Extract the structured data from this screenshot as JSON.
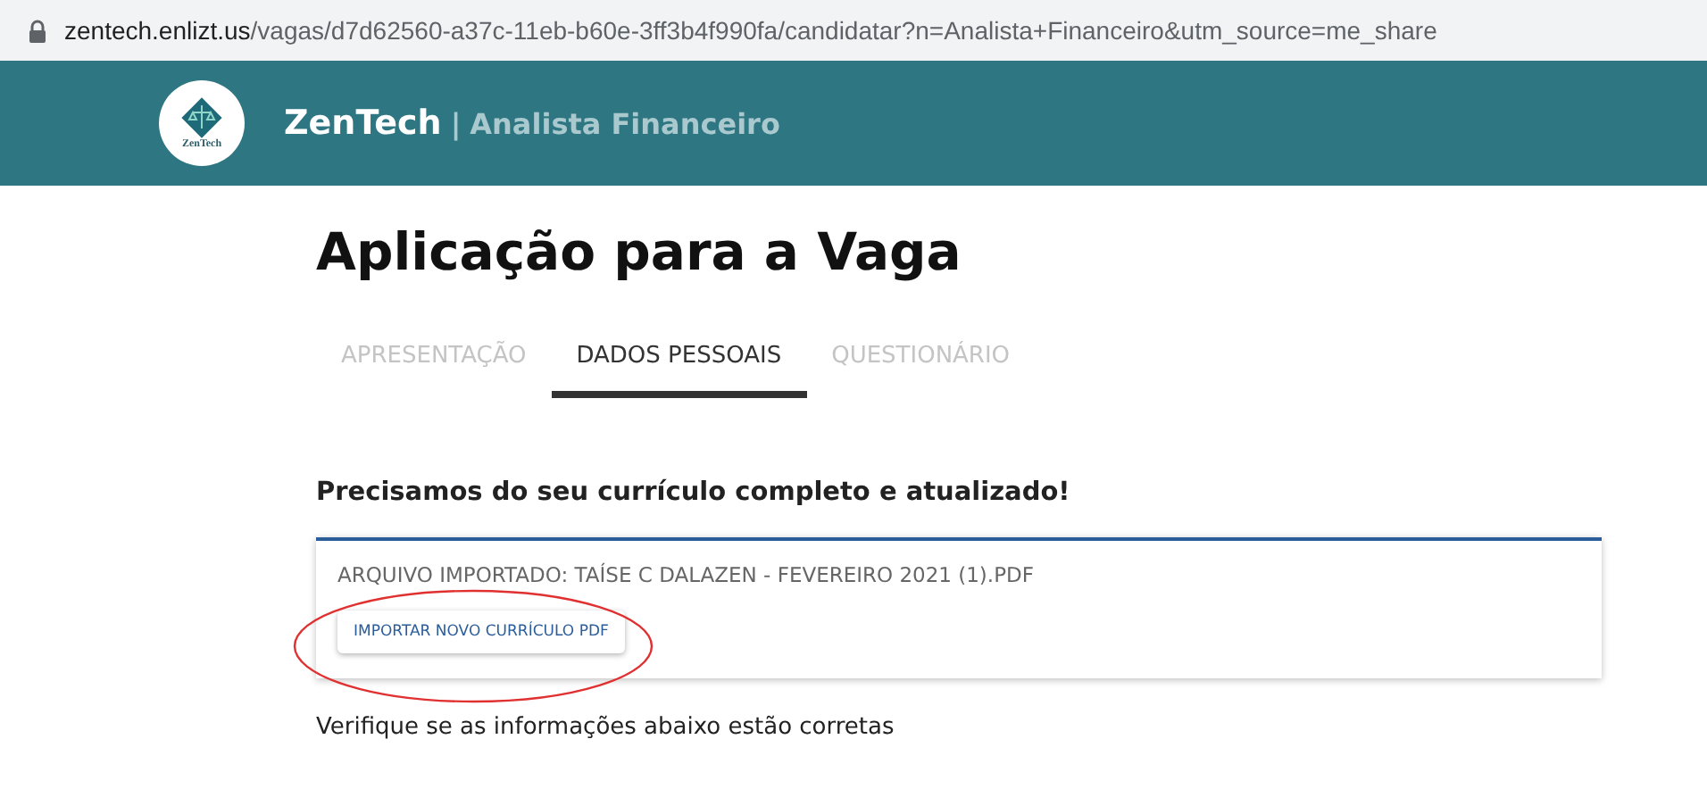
{
  "address_bar": {
    "domain": "zentech.enlizt.us",
    "path": "/vagas/d7d62560-a37c-11eb-b60e-3ff3b4f990fa/candidatar?n=Analista+Financeiro&utm_source=me_share"
  },
  "header": {
    "logo_text": "ZenTech",
    "company": "ZenTech",
    "separator": "|",
    "job_title": "Analista Financeiro"
  },
  "page_title": "Aplicação para a Vaga",
  "tabs": [
    {
      "label": "APRESENTAÇÃO",
      "selected": false
    },
    {
      "label": "DADOS PESSOAIS",
      "selected": true
    },
    {
      "label": "QUESTIONÁRIO",
      "selected": false
    }
  ],
  "section_heading": "Precisamos do seu currículo completo e atualizado!",
  "upload_card": {
    "file_label": "ARQUIVO IMPORTADO: TAÍSE C DALAZEN - FEVEREIRO 2021 (1).PDF",
    "button": "IMPORTAR NOVO CURRÍCULO PDF"
  },
  "next_text": "Verifique se as informações abaixo estão corretas"
}
